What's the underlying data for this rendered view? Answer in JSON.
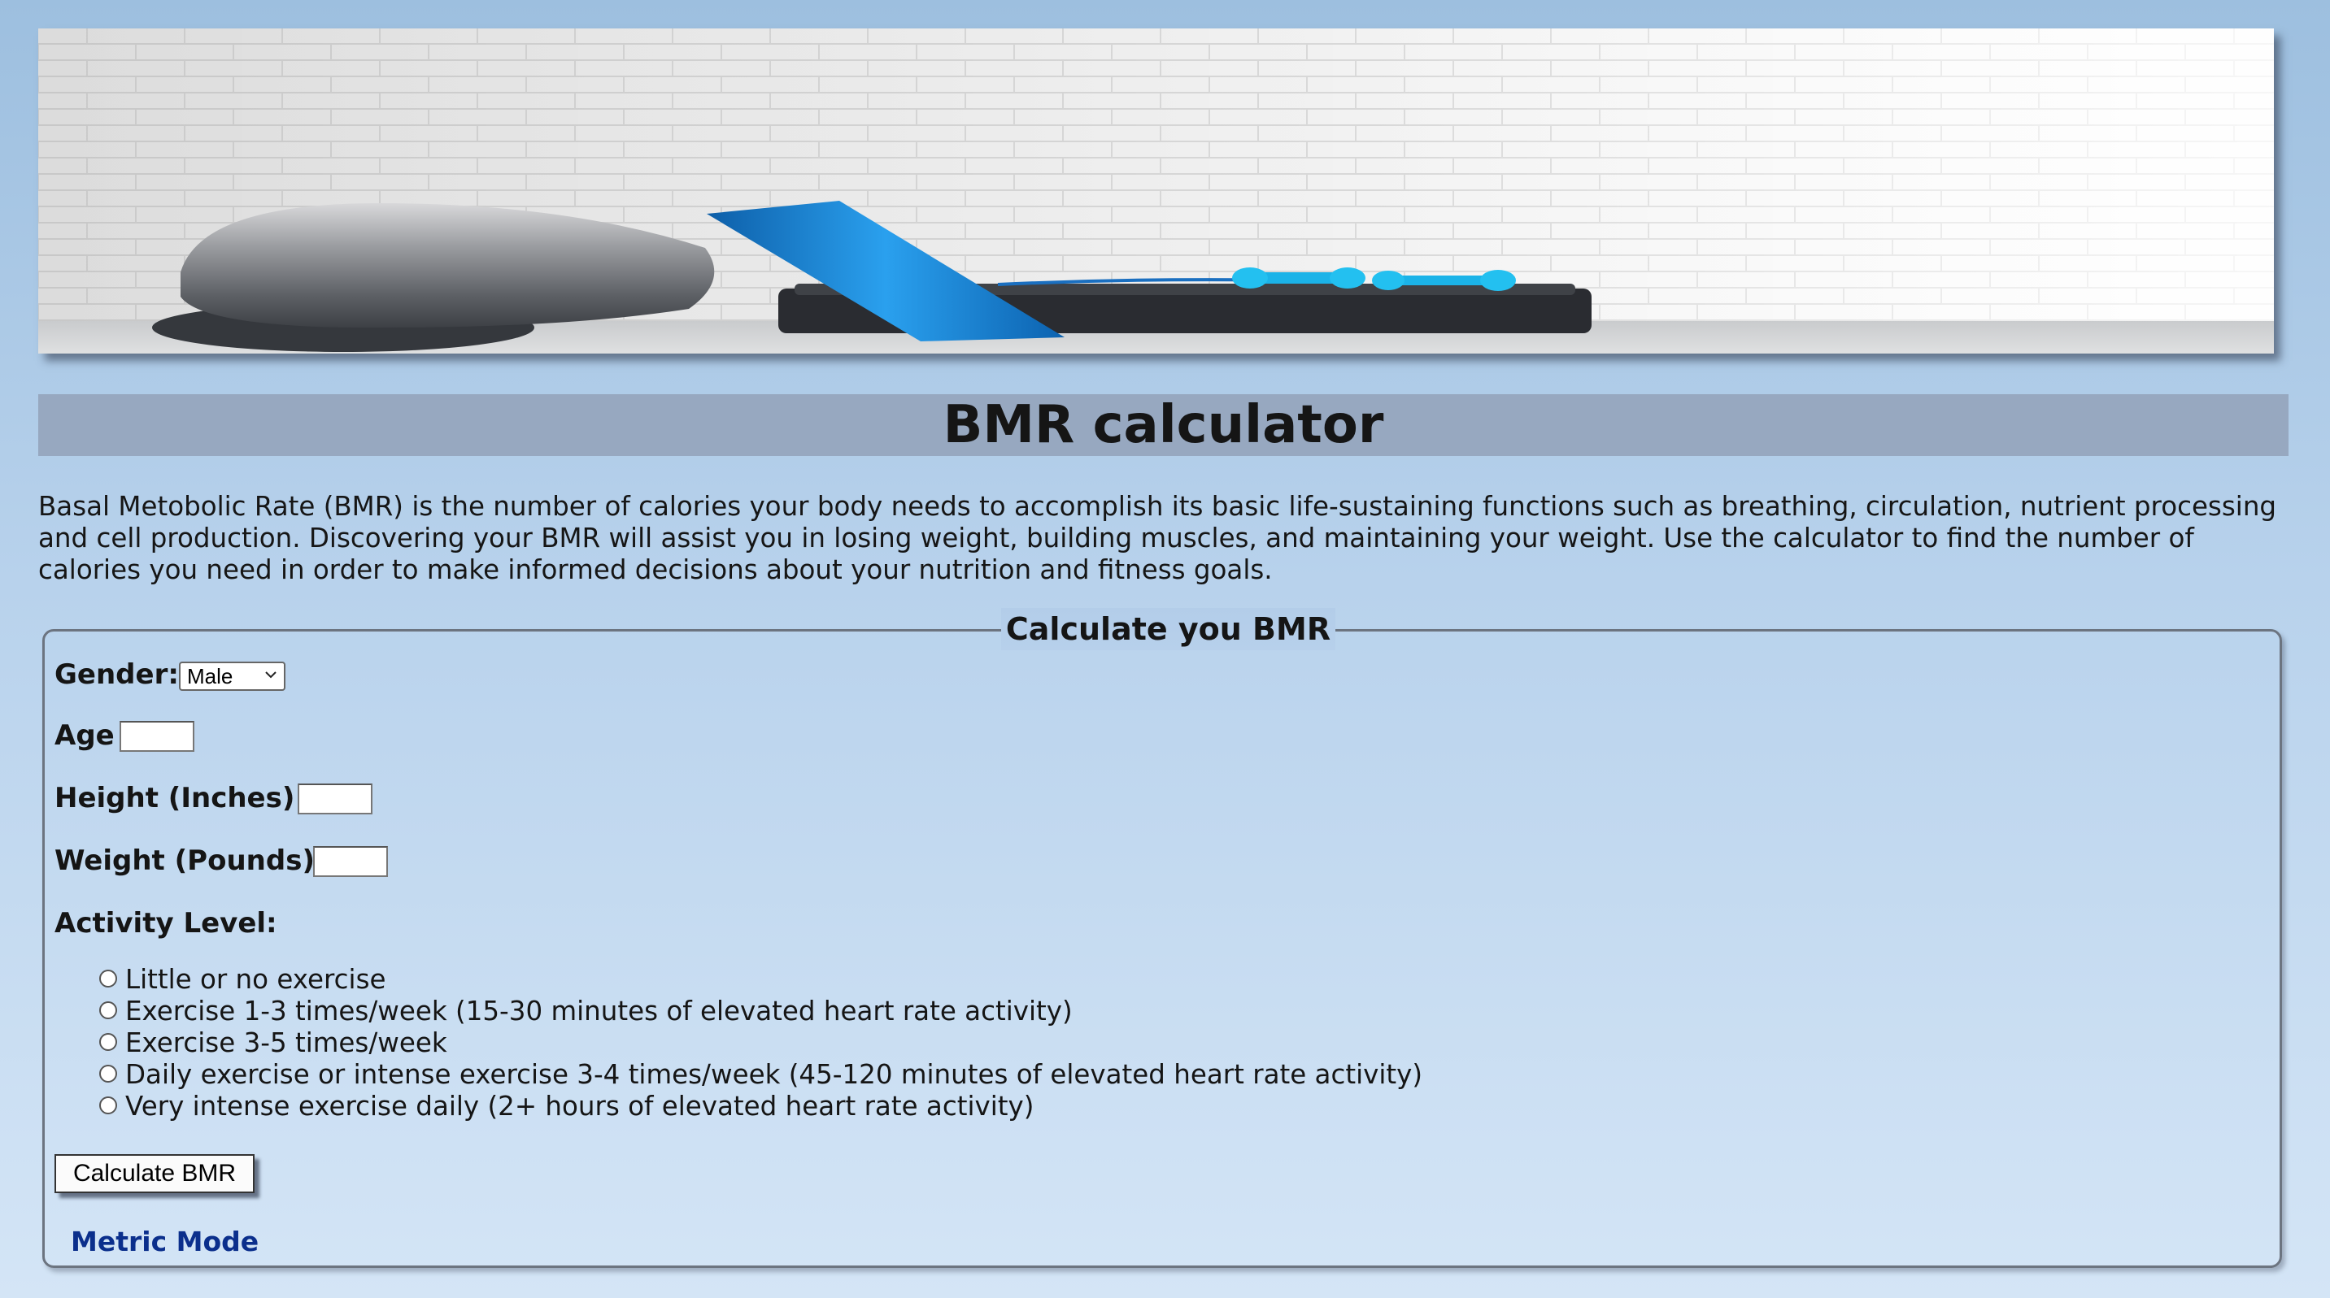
{
  "page": {
    "title": "BMR calculator",
    "intro": "Basal Metobolic Rate (BMR) is the number of calories your body needs to accomplish its basic life-sustaining functions such as breathing, circulation, nutrient processing and cell production. Discovering your BMR will assist you in losing weight, building muscles, and maintaining your weight. Use the calculator to find the number of calories you need in order to make informed decisions about your nutrition and fitness goals."
  },
  "form": {
    "legend": "Calculate you BMR",
    "gender_label": "Gender:",
    "gender_selected": "Male",
    "age_label": "Age",
    "age_value": "",
    "height_label": "Height (Inches)",
    "height_value": "",
    "weight_label": "Weight (Pounds)",
    "weight_value": "",
    "activity_label": "Activity Level:",
    "activity_options": [
      "Little or no exercise",
      "Exercise 1-3 times/week (15-30 minutes of elevated heart rate activity)",
      "Exercise 3-5 times/week",
      "Daily exercise or intense exercise 3-4 times/week (45-120 minutes of elevated heart rate activity)",
      "Very intense exercise daily (2+ hours of elevated heart rate activity)"
    ],
    "submit_label": "Calculate BMR",
    "metric_link": "Metric Mode"
  },
  "colors": {
    "title_bar": "#97a8c0",
    "link": "#0b2f8c",
    "mat": "#1f8fe0"
  },
  "icons": {
    "select_arrow": "chevron-down-icon"
  }
}
